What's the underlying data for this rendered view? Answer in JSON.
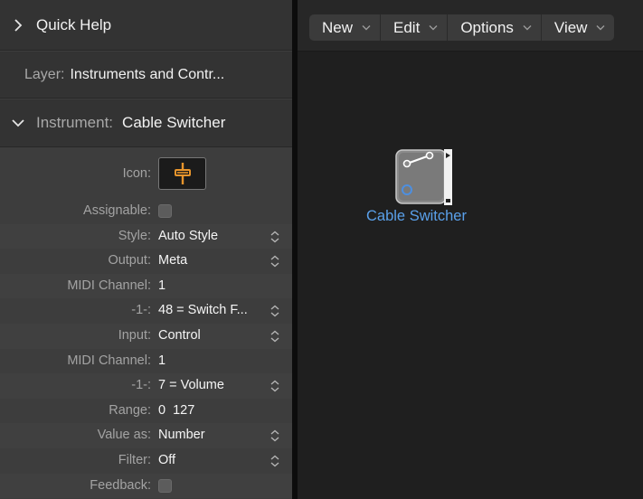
{
  "inspector": {
    "quick_help": "Quick Help",
    "layer_label": "Layer:",
    "layer_value": "Instruments and Contr...",
    "instrument_label": "Instrument:",
    "instrument_value": "Cable Switcher",
    "params": [
      {
        "label": "Icon:"
      },
      {
        "label": "Assignable:",
        "checked": false
      },
      {
        "label": "Style:",
        "value": "Auto Style"
      },
      {
        "label": "Output:",
        "value": "Meta"
      },
      {
        "label": "MIDI Channel:",
        "value": "1"
      },
      {
        "label": "-1-:",
        "value": "48 = Switch F..."
      },
      {
        "label": "Input:",
        "value": "Control"
      },
      {
        "label": "MIDI Channel:",
        "value": "1"
      },
      {
        "label": "-1-:",
        "value": "7 = Volume"
      },
      {
        "label": "Range:",
        "value": "0  127"
      },
      {
        "label": "Value as:",
        "value": "Number"
      },
      {
        "label": "Filter:",
        "value": "Off"
      },
      {
        "label": "Feedback:",
        "checked": false
      }
    ]
  },
  "menu": {
    "new": "New",
    "edit": "Edit",
    "options": "Options",
    "view": "View"
  },
  "canvas": {
    "object_label": "Cable Switcher"
  },
  "colors": {
    "accent_link": "#5aa0ea",
    "icon_orange": "#e8952c"
  }
}
